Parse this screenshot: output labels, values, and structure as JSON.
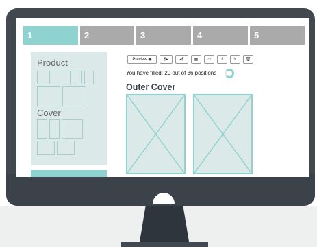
{
  "steps": [
    {
      "label": "1",
      "active": true
    },
    {
      "label": "2",
      "active": false
    },
    {
      "label": "3",
      "active": false
    },
    {
      "label": "4",
      "active": false
    },
    {
      "label": "5",
      "active": false
    }
  ],
  "sidebar": {
    "product_title": "Product",
    "cover_title": "Cover"
  },
  "toolbar": {
    "preview_label": "Preview",
    "buttons": [
      {
        "icon": "eye-icon",
        "glyph": "◉"
      },
      {
        "icon": "text-direction-rtl-icon",
        "glyph": "¶▸"
      },
      {
        "icon": "text-direction-ltr-icon",
        "glyph": "◂¶"
      },
      {
        "icon": "grid-icon",
        "glyph": "▦"
      },
      {
        "icon": "note-icon",
        "glyph": "▱"
      },
      {
        "icon": "download-icon",
        "glyph": "⤓"
      },
      {
        "icon": "wand-icon",
        "glyph": "✎"
      },
      {
        "icon": "trash-icon",
        "glyph": "🗑"
      }
    ]
  },
  "progress": {
    "text": "You have filled: 20 out of 36 positions",
    "filled": 20,
    "total": 36
  },
  "main": {
    "section_title": "Outer Cover"
  },
  "colors": {
    "accent": "#8ed3cf",
    "inactive_step": "#aaaaaa",
    "monitor": "#414850",
    "panel": "#dbe9e8"
  }
}
